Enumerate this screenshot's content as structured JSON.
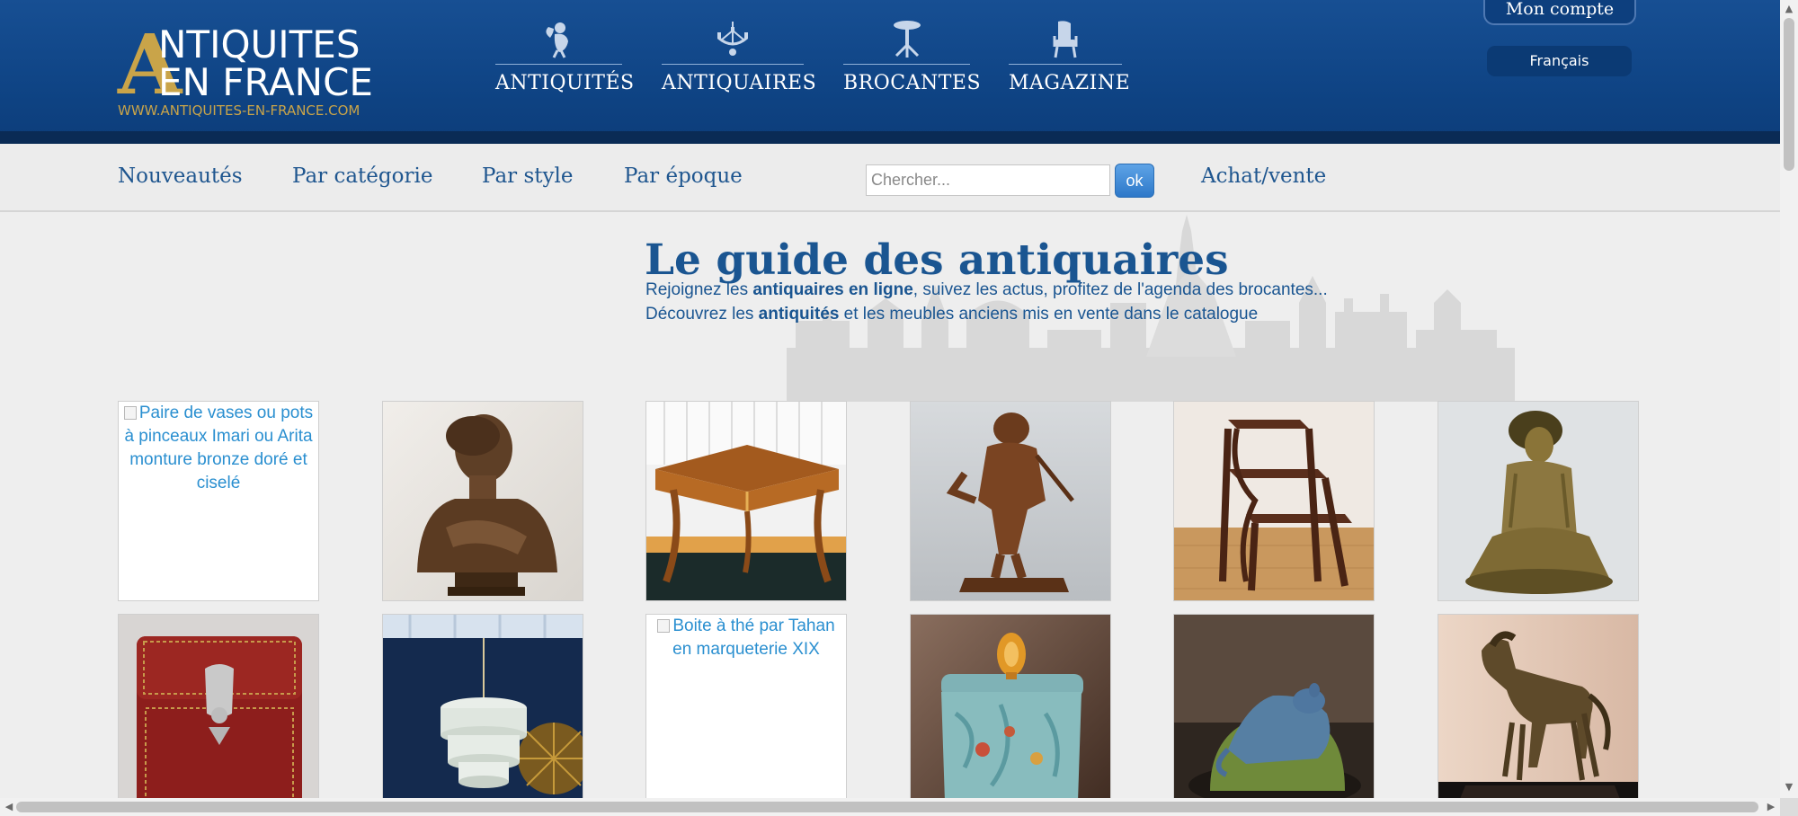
{
  "logo": {
    "letter": "A",
    "line1": "NTIQUITES",
    "line2": "EN FRANCE",
    "url": "WWW.ANTIQUITES-EN-FRANCE.COM"
  },
  "main_nav": [
    {
      "label": "ANTIQUITÉS",
      "icon": "cherub-icon"
    },
    {
      "label": "ANTIQUAIRES",
      "icon": "chandelier-icon"
    },
    {
      "label": "BROCANTES",
      "icon": "gueridon-table-icon"
    },
    {
      "label": "MAGAZINE",
      "icon": "armchair-icon"
    }
  ],
  "account": {
    "label": "Mon compte"
  },
  "language": {
    "label": "Français"
  },
  "subnav": {
    "items": [
      "Nouveautés",
      "Par catégorie",
      "Par style",
      "Par époque"
    ],
    "search_placeholder": "Chercher...",
    "search_button": "ok",
    "achat": "Achat/vente"
  },
  "guide": {
    "title": "Le guide des antiquaires",
    "line1_pre": "Rejoignez les ",
    "line1_bold": "antiquaires en ligne",
    "line1_post": ", suivez les actus, profitez de l'agenda des brocantes...",
    "line2_pre": "Découvrez les ",
    "line2_bold": "antiquités",
    "line2_post": " et les meubles anciens mis en vente dans le catalogue"
  },
  "items": [
    {
      "alt": "Paire de vases ou pots à pinceaux Imari ou Arita monture bronze doré et ciselé",
      "image": "broken"
    },
    {
      "alt": "",
      "image": "bronze-bust"
    },
    {
      "alt": "",
      "image": "marquetry-side-table"
    },
    {
      "alt": "",
      "image": "bronze-figure-scythe"
    },
    {
      "alt": "",
      "image": "wooden-library-steps"
    },
    {
      "alt": "",
      "image": "bronze-sculpture"
    },
    {
      "alt": "",
      "image": "red-leather-case"
    },
    {
      "alt": "",
      "image": "glass-chandelier"
    },
    {
      "alt": "Boite à thé par Tahan en marqueterie XIX",
      "image": "broken"
    },
    {
      "alt": "",
      "image": "glass-box"
    },
    {
      "alt": "",
      "image": "glass-animal"
    },
    {
      "alt": "",
      "image": "bronze-horse"
    }
  ],
  "colors": {
    "header_blue": "#0f4485",
    "gold": "#c9a449",
    "link_blue": "#1a5591",
    "alt_text": "#2a8fd0"
  }
}
